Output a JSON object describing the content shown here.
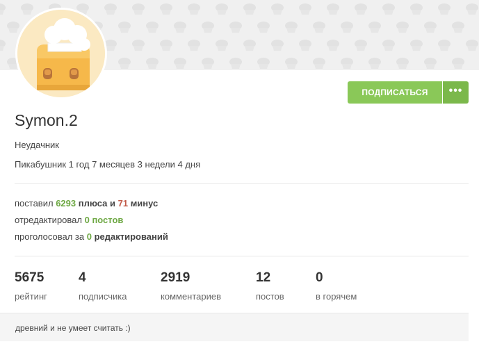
{
  "profile": {
    "username": "Symon.2",
    "status": "Неудачник",
    "tenure": "Пикабушник 1 год 7 месяцев 3 недели 4 дня",
    "about": "древний и не умеет считать :)"
  },
  "actions": {
    "subscribe_label": "ПОДПИСАТЬСЯ",
    "more_label": "•••"
  },
  "activity": {
    "rated_prefix": "поставил ",
    "pluses_count": "6293",
    "pluses_word": " плюса",
    "and_word": " и ",
    "minuses_count": "71",
    "minuses_word": " минус",
    "edited_prefix": "отредактировал ",
    "edited_count": "0",
    "edited_word": " постов",
    "voted_prefix": "проголосовал за ",
    "voted_count": "0",
    "voted_word": " редактирований"
  },
  "stats": [
    {
      "value": "5675",
      "label": "рейтинг"
    },
    {
      "value": "4",
      "label": "подписчика"
    },
    {
      "value": "2919",
      "label": "комментариев"
    },
    {
      "value": "12",
      "label": "постов"
    },
    {
      "value": "0",
      "label": "в горячем"
    }
  ],
  "colors": {
    "accent_green": "#8ac858",
    "plus_green": "#6ea844",
    "minus_red": "#c15a48",
    "banner_bg": "#f0f0f0"
  },
  "icons": {
    "banner_pattern": "cupcake-pattern",
    "avatar": "toaster-chef-avatar",
    "more": "ellipsis-icon"
  }
}
